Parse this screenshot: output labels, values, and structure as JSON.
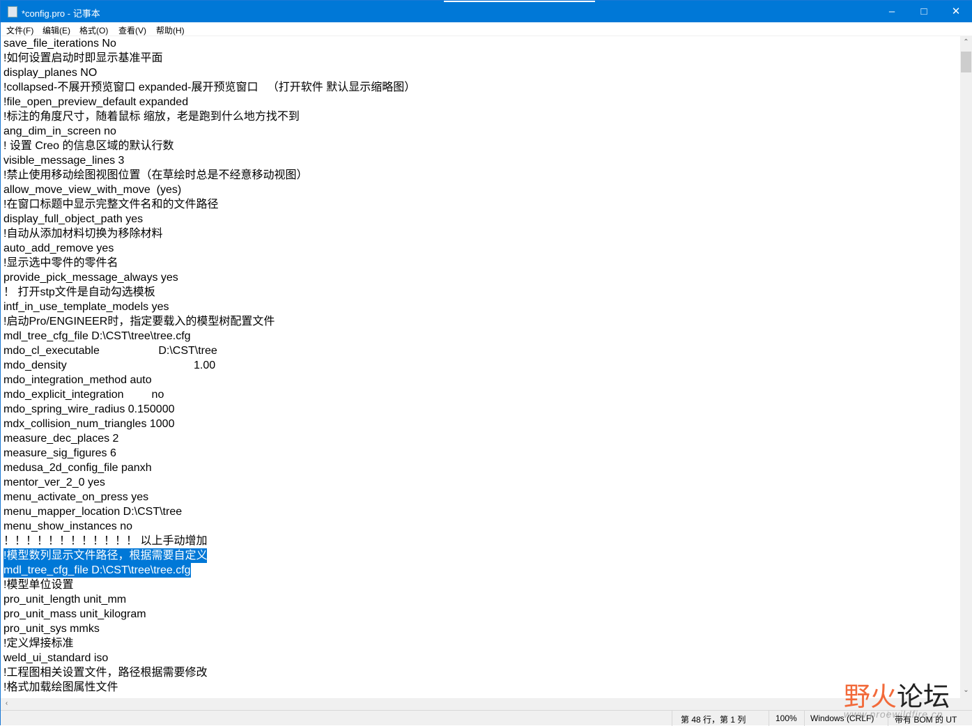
{
  "window": {
    "title": "*config.pro - 记事本",
    "icon": "notepad-icon",
    "controls": [
      "minimize-icon",
      "maximize-icon",
      "close-icon"
    ]
  },
  "menu": [
    "文件(F)",
    "编辑(E)",
    "格式(O)",
    "查看(V)",
    "帮助(H)"
  ],
  "lines": [
    "save_file_iterations No",
    "!如何设置启动时即显示基准平面",
    "display_planes NO",
    "!collapsed-不展开预览窗口 expanded-展开预览窗口   （打开软件 默认显示缩略图）",
    "!file_open_preview_default expanded",
    "!标注的角度尺寸，随着鼠标 缩放，老是跑到什么地方找不到",
    "ang_dim_in_screen no",
    "! 设置 Creo 的信息区域的默认行数",
    "visible_message_lines 3",
    "!禁止使用移动绘图视图位置（在草绘时总是不经意移动视图）",
    "allow_move_view_with_move  (yes)",
    "!在窗口标题中显示完整文件名和的文件路径",
    "display_full_object_path yes",
    "!自动从添加材料切换为移除材料",
    "auto_add_remove yes",
    "!显示选中零件的零件名",
    "provide_pick_message_always yes",
    "！ 打开stp文件是自动勾选模板",
    "intf_in_use_template_models yes",
    "!启动Pro/ENGINEER时，指定要载入的模型树配置文件",
    "mdl_tree_cfg_file D:\\CST\\tree\\tree.cfg",
    "mdo_cl_executable                   D:\\CST\\tree",
    "mdo_density                                         1.00",
    "mdo_integration_method auto",
    "mdo_explicit_integration         no",
    "mdo_spring_wire_radius 0.150000",
    "mdx_collision_num_triangles 1000",
    "measure_dec_places 2",
    "measure_sig_figures 6",
    "medusa_2d_config_file panxh",
    "mentor_ver_2_0 yes",
    "menu_activate_on_press yes",
    "menu_mapper_location D:\\CST\\tree",
    "menu_show_instances no",
    "！！！！！！！！！！！！ 以上手动增加",
    "!模型数列显示文件路径，根据需要自定义",
    "mdl_tree_cfg_file D:\\CST\\tree\\tree.cfg",
    "!模型单位设置",
    "pro_unit_length unit_mm",
    "pro_unit_mass unit_kilogram",
    "pro_unit_sys mmks",
    "!定义焊接标准",
    "weld_ui_standard iso",
    "!工程图相关设置文件，路径根据需要修改",
    "!格式加载绘图属性文件"
  ],
  "selected_lines": [
    35,
    36
  ],
  "status": {
    "position": "第 48 行，第 1 列",
    "zoom": "100%",
    "eol": "Windows (CRLF)",
    "encoding": "带有 BOM 的 UT"
  },
  "watermark": {
    "text_a": "野火",
    "text_b": "论坛",
    "url": "www.proewildfire.cn"
  },
  "colors": {
    "accent": "#0078d7",
    "selection": "#0078d7",
    "watermark": "#f26a3a"
  }
}
